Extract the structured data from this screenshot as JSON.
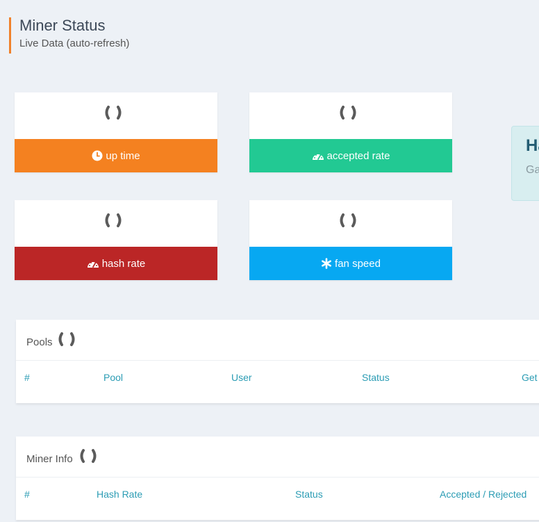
{
  "header": {
    "title": "Miner Status",
    "subtitle": "Live Data (auto-refresh)"
  },
  "stat_cards": [
    {
      "label": "up time",
      "icon": "clock-icon",
      "color": "#f48120"
    },
    {
      "label": "accepted rate",
      "icon": "dashboard-icon",
      "color": "#22c993"
    },
    {
      "label": "hash rate",
      "icon": "dashboard-icon",
      "color": "#bb2626"
    },
    {
      "label": "fan speed",
      "icon": "asterisk-icon",
      "color": "#07a8f2"
    }
  ],
  "alert": {
    "title": "Ha",
    "text": "Ga"
  },
  "pools_panel": {
    "title": "Pools",
    "columns": [
      "#",
      "Pool",
      "User",
      "Status",
      "Get"
    ]
  },
  "miner_info_panel": {
    "title": "Miner Info",
    "columns": [
      "#",
      "Hash Rate",
      "Status",
      "Accepted / Rejected"
    ]
  },
  "colors": {
    "accent": "#f0812b",
    "table_header": "#2b9cb4",
    "background": "#edf1f6"
  }
}
